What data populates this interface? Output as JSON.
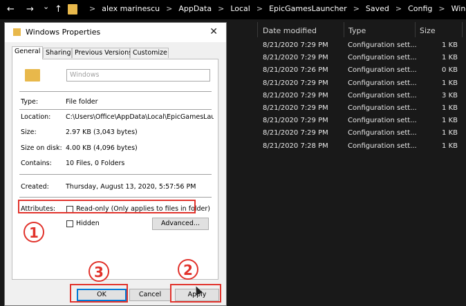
{
  "explorer": {
    "nav": {
      "back": "←",
      "forward": "→",
      "recent": "⌄",
      "up": "↑"
    },
    "breadcrumb": [
      "alex marinescu",
      "AppData",
      "Local",
      "EpicGamesLauncher",
      "Saved",
      "Config",
      "Windows"
    ],
    "separator": ">",
    "columns": [
      "Date modified",
      "Type",
      "Size"
    ],
    "rows": [
      {
        "date": "8/21/2020 7:29 PM",
        "type": "Configuration sett...",
        "size": "1 KB"
      },
      {
        "date": "8/21/2020 7:29 PM",
        "type": "Configuration sett...",
        "size": "1 KB"
      },
      {
        "date": "8/21/2020 7:26 PM",
        "type": "Configuration sett...",
        "size": "0 KB"
      },
      {
        "date": "8/21/2020 7:29 PM",
        "type": "Configuration sett...",
        "size": "1 KB"
      },
      {
        "date": "8/21/2020 7:29 PM",
        "type": "Configuration sett...",
        "size": "3 KB"
      },
      {
        "date": "8/21/2020 7:29 PM",
        "type": "Configuration sett...",
        "size": "1 KB"
      },
      {
        "date": "8/21/2020 7:29 PM",
        "type": "Configuration sett...",
        "size": "1 KB"
      },
      {
        "date": "8/21/2020 7:29 PM",
        "type": "Configuration sett...",
        "size": "1 KB"
      },
      {
        "date": "8/21/2020 7:28 PM",
        "type": "Configuration sett...",
        "size": "1 KB"
      }
    ]
  },
  "dialog": {
    "title": "Windows Properties",
    "close": "✕",
    "tabs": [
      "General",
      "Sharing",
      "Previous Versions",
      "Customize"
    ],
    "folder_name": "Windows",
    "props": {
      "type_label": "Type:",
      "type_value": "File folder",
      "location_label": "Location:",
      "location_value": "C:\\Users\\Office\\AppData\\Local\\EpicGamesLauncher",
      "size_label": "Size:",
      "size_value": "2.97 KB (3,043 bytes)",
      "size_on_disk_label": "Size on disk:",
      "size_on_disk_value": "4.00 KB (4,096 bytes)",
      "contains_label": "Contains:",
      "contains_value": "10 Files, 0 Folders",
      "created_label": "Created:",
      "created_value": "Thursday, August 13, 2020, 5:57:56 PM",
      "attributes_label": "Attributes:"
    },
    "readonly_label": "Read-only (Only applies to files in folder)",
    "readonly_checked": false,
    "hidden_label": "Hidden",
    "hidden_checked": false,
    "advanced_button": "Advanced...",
    "ok_button": "OK",
    "cancel_button": "Cancel",
    "apply_button": "Apply"
  },
  "annotations": {
    "step1": "1",
    "step2": "2",
    "step3": "3",
    "color": "#e1322b"
  }
}
